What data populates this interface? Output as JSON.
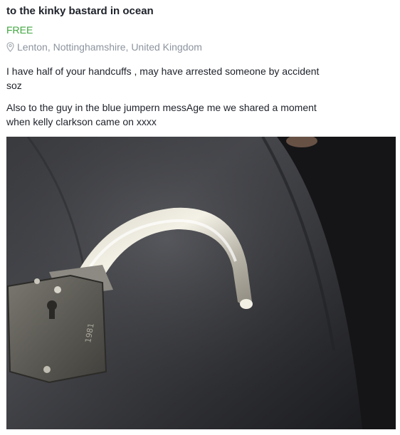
{
  "listing": {
    "title": "to the kinky bastard in ocean",
    "price": "FREE",
    "location": "Lenton, Nottinghamshire, United Kingdom",
    "description_1": [
      "I have half of your handcuffs , may have arrested someone by accident",
      "soz"
    ],
    "description_2": [
      "Also to the guy in the blue jumpern messAge me we shared a moment",
      "when kelly clarkson came on xxxx"
    ],
    "photo_engraving": "1981"
  },
  "colors": {
    "price": "#3fa73f",
    "location": "#8d949e",
    "text": "#1d2129"
  },
  "icons": {
    "location": "map-pin-icon"
  }
}
